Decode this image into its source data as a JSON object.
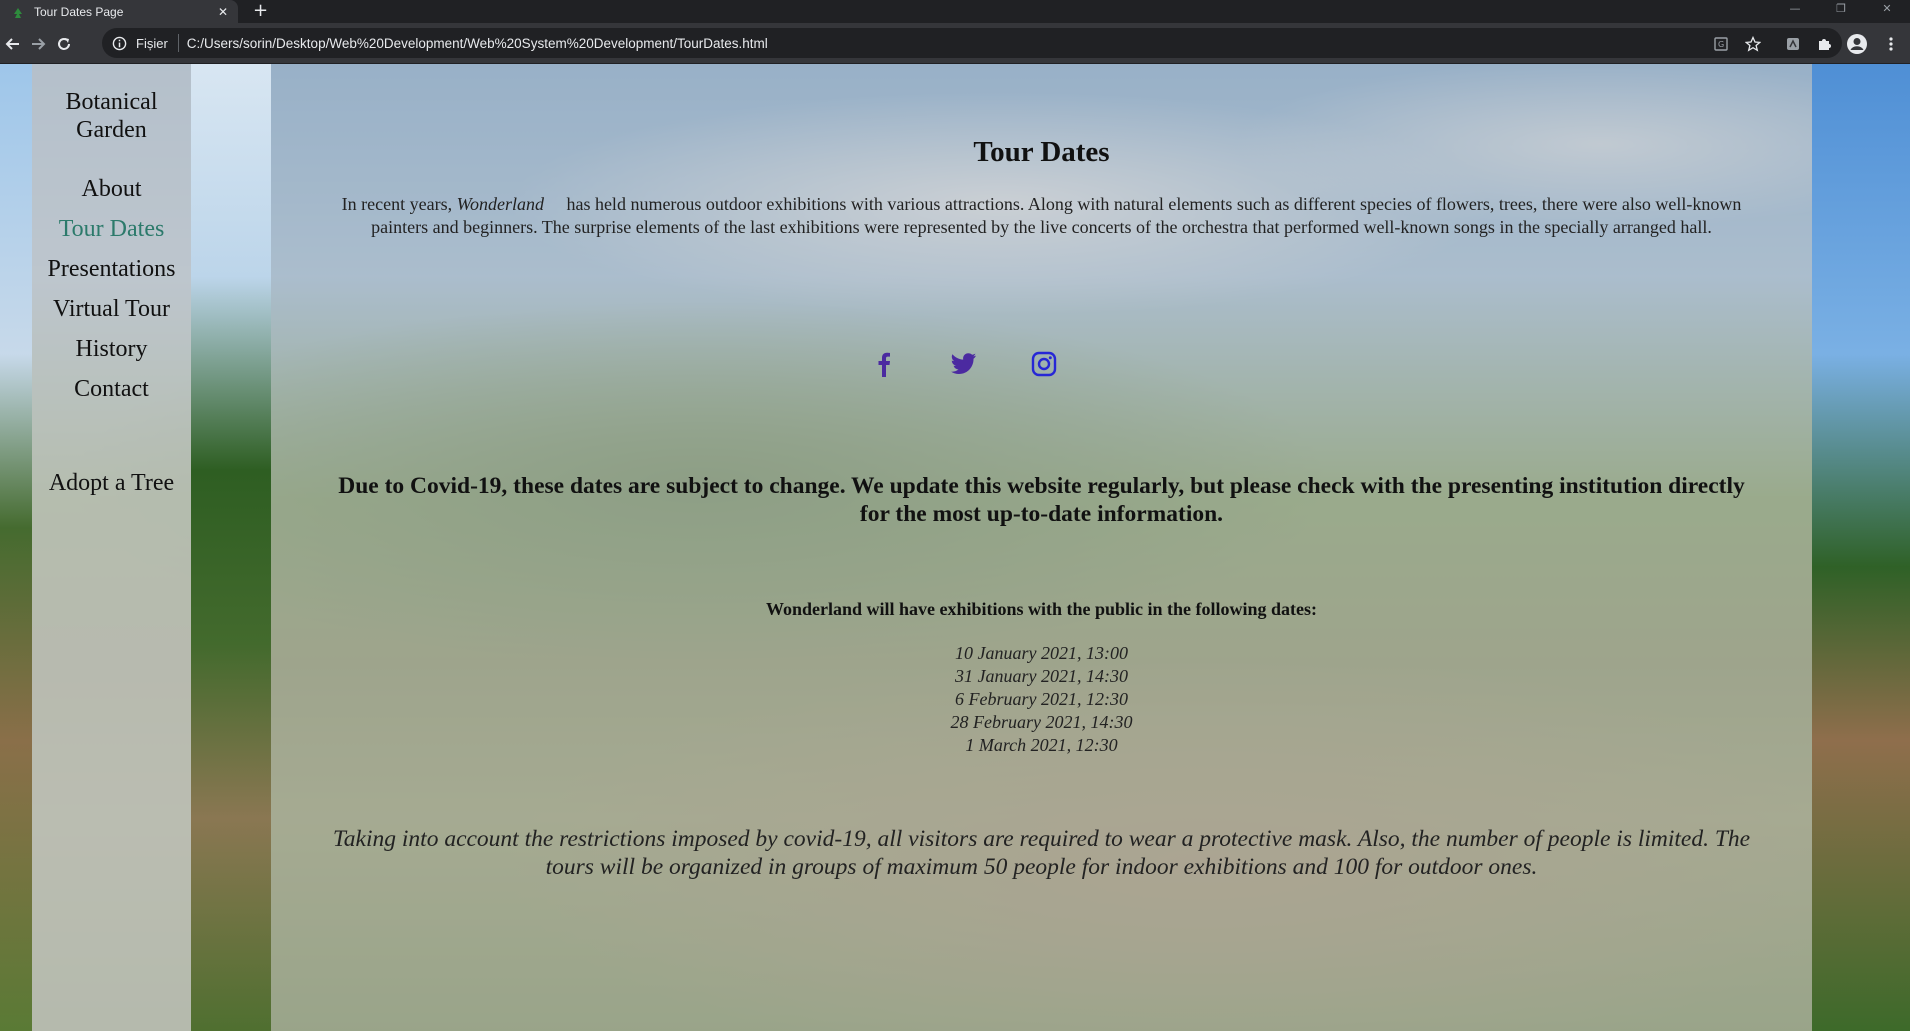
{
  "browser": {
    "tab_title": "Tour Dates Page",
    "tab_close": "✕",
    "new_tab": "+",
    "window_controls": {
      "minimize": "—",
      "restore": "❐",
      "close": "✕"
    },
    "omnibox_chip": "Fișier",
    "url": "C:/Users/sorin/Desktop/Web%20Development/Web%20System%20Development/TourDates.html",
    "icons": [
      "back-icon",
      "forward-icon",
      "reload-icon",
      "info-icon",
      "translate-icon",
      "bookmark-star-icon",
      "extension-icon",
      "extensions-puzzle-icon",
      "profile-icon",
      "menu-dots-icon"
    ]
  },
  "sidebar": {
    "logo": "Botanical Garden",
    "items": [
      {
        "label": "About",
        "active": false
      },
      {
        "label": "Tour Dates",
        "active": true
      },
      {
        "label": "Presentations",
        "active": false
      },
      {
        "label": "Virtual Tour",
        "active": false
      },
      {
        "label": "History",
        "active": false
      },
      {
        "label": "Contact",
        "active": false
      }
    ],
    "extra": "Adopt a Tree"
  },
  "main": {
    "title": "Tour Dates",
    "intro_before": "In recent years, ",
    "intro_em": "Wonderland",
    "intro_after": "     has held numerous outdoor exhibitions with various attractions. Along with natural elements such as different species of flowers, trees, there were also well-known painters and beginners. The surprise elements of the last exhibitions were represented by the live concerts of the orchestra that performed well-known songs in the specially arranged hall.",
    "socials": [
      {
        "icon": "facebook-icon",
        "color": "#4b2aa0"
      },
      {
        "icon": "twitter-icon",
        "color": "#4b2aa0"
      },
      {
        "icon": "instagram-icon",
        "color": "#2727d6"
      }
    ],
    "covid_notice": "Due to Covid-19, these dates are subject to change. We update this website regularly, but please check with the presenting institution directly for the most up-to-date information.",
    "dates_heading": "Wonderland will have exhibitions with the public in the following dates:",
    "dates": [
      "10 January 2021, 13:00",
      "31 January 2021, 14:30",
      "6 February 2021, 12:30",
      "28 February 2021, 14:30",
      "1 March 2021, 12:30"
    ],
    "mask_note": "Taking into account the restrictions imposed by covid-19, all visitors are required to wear a protective mask. Also, the number of people is limited. The tours will be organized in groups of maximum 50 people for indoor exhibitions and 100 for outdoor ones."
  },
  "colors": {
    "active_menu": "#2c7a6b",
    "social_purple": "#4b2aa0",
    "social_blue": "#2727d6",
    "chrome_dark": "#202124",
    "chrome_toolbar": "#35363a"
  }
}
